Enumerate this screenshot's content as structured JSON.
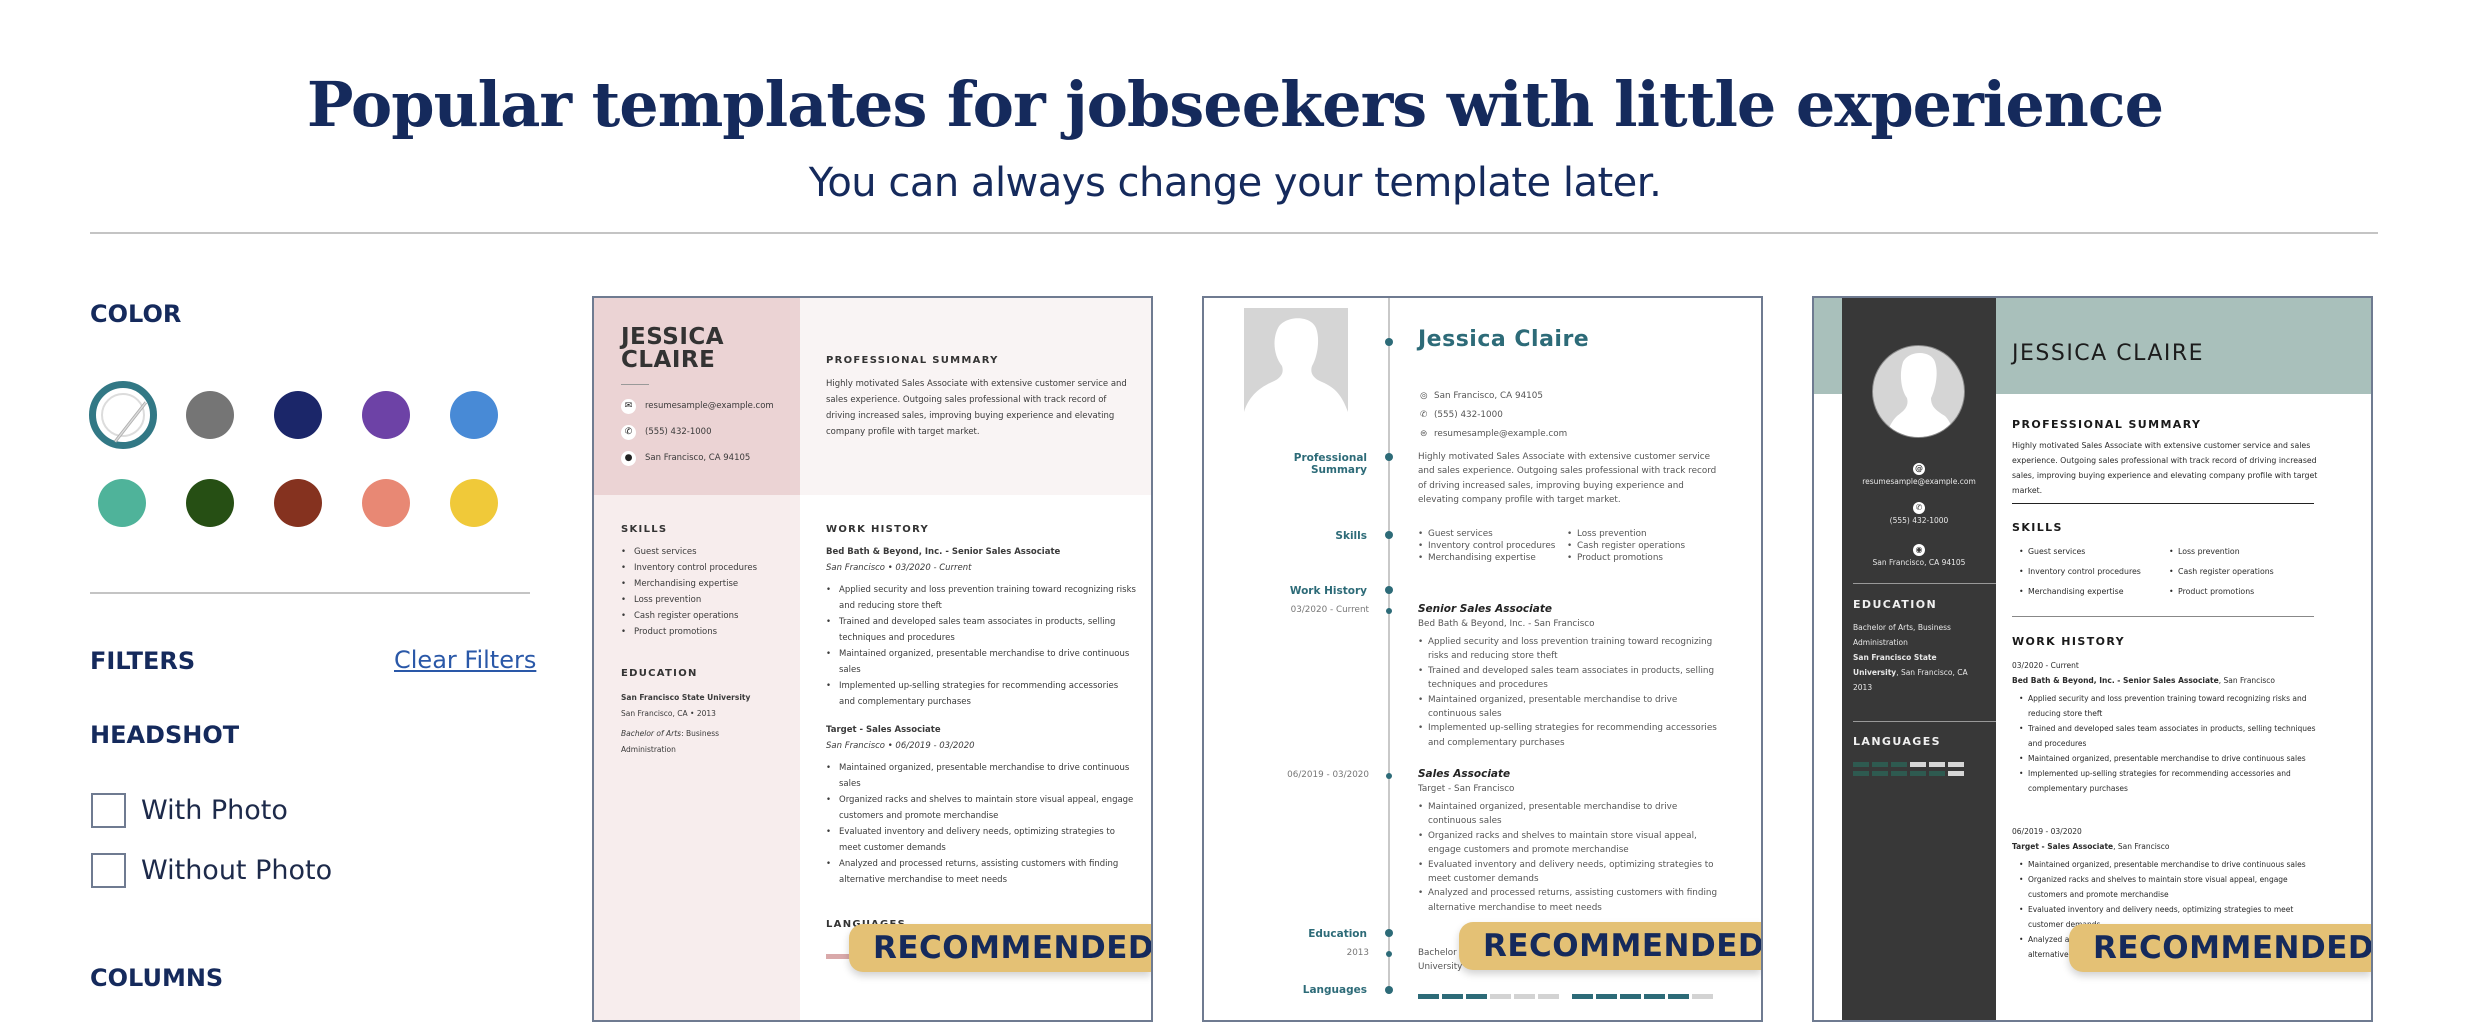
{
  "header": {
    "title": "Popular templates for jobseekers with little experience",
    "subtitle": "You can always change your template later."
  },
  "sidebar": {
    "color_heading": "COLOR",
    "colors": [
      {
        "name": "no-color",
        "hex": "#ffffff",
        "selected": true
      },
      {
        "name": "gray",
        "hex": "#757575",
        "selected": false
      },
      {
        "name": "navy",
        "hex": "#1b2669",
        "selected": false
      },
      {
        "name": "purple",
        "hex": "#6d42a6",
        "selected": false
      },
      {
        "name": "blue",
        "hex": "#488ad6",
        "selected": false
      },
      {
        "name": "teal",
        "hex": "#4fb39a",
        "selected": false
      },
      {
        "name": "dark-green",
        "hex": "#264f14",
        "selected": false
      },
      {
        "name": "brown",
        "hex": "#85321f",
        "selected": false
      },
      {
        "name": "salmon",
        "hex": "#e88874",
        "selected": false
      },
      {
        "name": "yellow",
        "hex": "#f0c939",
        "selected": false
      }
    ],
    "filters_heading": "FILTERS",
    "clear_filters": "Clear Filters",
    "headshot_heading": "HEADSHOT",
    "headshot_options": [
      {
        "label": "With Photo",
        "checked": false
      },
      {
        "label": "Without Photo",
        "checked": false
      }
    ],
    "columns_heading": "COLUMNS"
  },
  "badge_label": "RECOMMENDED",
  "resume": {
    "first_name": "JESSICA",
    "last_name": "CLAIRE",
    "full_name_upper": "JESSICA CLAIRE",
    "full_name": "Jessica Claire",
    "email": "resumesample@example.com",
    "phone": "(555) 432-1000",
    "location": "San Francisco, CA 94105",
    "headings": {
      "summary_upper": "PROFESSIONAL SUMMARY",
      "skills_upper": "SKILLS",
      "education_upper": "EDUCATION",
      "work_upper": "WORK HISTORY",
      "languages_upper": "LANGUAGES",
      "summary": "Professional Summary",
      "skills": "Skills",
      "work": "Work History",
      "education": "Education",
      "languages": "Languages"
    },
    "summary": "Highly motivated Sales Associate with extensive customer service and sales experience. Outgoing sales professional with track record of driving increased sales, improving buying experience and elevating company profile with target market.",
    "skills": [
      "Guest services",
      "Inventory control procedures",
      "Merchandising expertise",
      "Loss prevention",
      "Cash register operations",
      "Product promotions"
    ],
    "education": {
      "school": "San Francisco State University",
      "school_line1": "San Francisco State",
      "school_line2": "University",
      "location_year": "San Francisco, CA  •  2013",
      "city_state": ", San Francisco, CA",
      "year": "2013",
      "degree": "Bachelor of Arts",
      "degree_full": "Bachelor of Arts, Business Administration",
      "field": ": Business Administration",
      "t2_line1": "Bachelor of Arts, Business Administration: San Francisco State",
      "t2_line2": "University - San Francisco, CA"
    },
    "jobs": [
      {
        "company": "Bed Bath & Beyond, Inc.",
        "title": "Senior Sales Associate",
        "header_line": "Bed Bath & Beyond, Inc. - Senior Sales Associate",
        "company_city": "Bed Bath & Beyond, Inc. - San Francisco",
        "city": "San Francisco",
        "city_suffix": ", San Francisco",
        "dates": "03/2020 - Current",
        "meta_line": "San Francisco  •  03/2020 - Current",
        "bullets": [
          "Applied security and loss prevention training toward recognizing risks and reducing store theft",
          "Trained and developed sales team associates in products, selling techniques and procedures",
          "Maintained organized, presentable merchandise to drive continuous sales",
          "Implemented up-selling strategies for recommending accessories and complementary purchases"
        ]
      },
      {
        "company": "Target",
        "title": "Sales Associate",
        "header_line": "Target - Sales Associate",
        "company_city": "Target - San Francisco",
        "city": "San Francisco",
        "city_suffix": ", San Francisco",
        "dates": "06/2019 - 03/2020",
        "meta_line": "San Francisco  •  06/2019 - 03/2020",
        "bullets": [
          "Maintained organized, presentable merchandise to drive continuous sales",
          "Organized racks and shelves to maintain store visual appeal, engage customers and promote merchandise",
          "Evaluated inventory and delivery needs, optimizing strategies to meet customer demands",
          "Analyzed and processed returns, assisting customers with finding alternative merchandise to meet needs"
        ]
      }
    ],
    "language_levels": [
      3,
      5
    ],
    "language_scale": 6
  },
  "templates": [
    {
      "id": "template-1",
      "accent": "#ebd3d4",
      "recommended": true
    },
    {
      "id": "template-2",
      "accent": "#2d6b78",
      "recommended": true
    },
    {
      "id": "template-3",
      "accent": "#a9c0bb",
      "recommended": true
    }
  ]
}
